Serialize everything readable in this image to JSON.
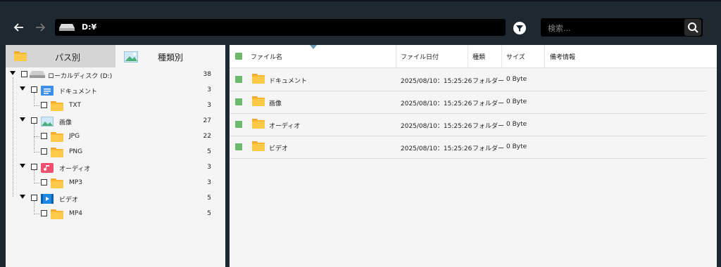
{
  "toolbar": {
    "back_icon": "arrow-left-icon",
    "forward_icon": "arrow-right-icon",
    "address": "D:¥",
    "filter_icon": "filter-icon",
    "search_placeholder": "検索..."
  },
  "tabs": {
    "path": "パス別",
    "type": "種類別"
  },
  "tree": {
    "root": {
      "label": "ローカルディスク (D:)",
      "count": "38"
    },
    "documents": {
      "label": "ドキュメント",
      "count": "3"
    },
    "txt": {
      "label": "TXT",
      "count": "3"
    },
    "images": {
      "label": "画像",
      "count": "27"
    },
    "jpg": {
      "label": "JPG",
      "count": "22"
    },
    "png": {
      "label": "PNG",
      "count": "5"
    },
    "audio": {
      "label": "オーディオ",
      "count": "3"
    },
    "mp3": {
      "label": "MP3",
      "count": "3"
    },
    "video": {
      "label": "ビデオ",
      "count": "5"
    },
    "mp4": {
      "label": "MP4",
      "count": "5"
    }
  },
  "columns": {
    "name": "ファイル名",
    "date": "ファイル日付",
    "type": "種類",
    "size": "サイズ",
    "note": "備考情報"
  },
  "files": [
    {
      "name": "ドキュメント",
      "date": "2025/08/10：15:25:26",
      "type": "フォルダー",
      "size": "0 Byte"
    },
    {
      "name": "画像",
      "date": "2025/08/10：15:25:26",
      "type": "フォルダー",
      "size": "0 Byte"
    },
    {
      "name": "オーディオ",
      "date": "2025/08/10：15:25:26",
      "type": "フォルダー",
      "size": "0 Byte"
    },
    {
      "name": "ビデオ",
      "date": "2025/08/10：15:25:26",
      "type": "フォルダー",
      "size": "0 Byte"
    }
  ],
  "colors": {
    "accent_green": "#6cb96c",
    "folder_yellow": "#fdc949",
    "dark_bg": "#1e2831"
  }
}
